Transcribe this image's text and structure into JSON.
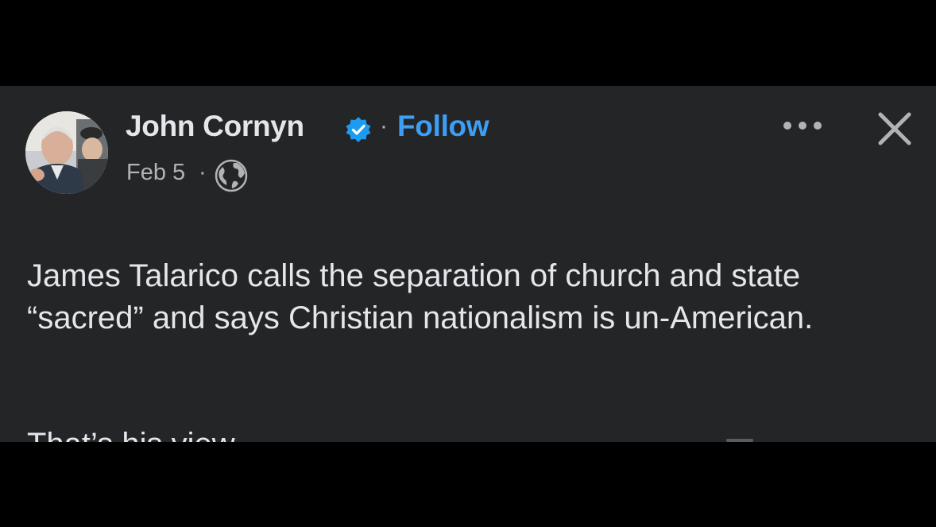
{
  "post": {
    "author": "John Cornyn",
    "separator": "·",
    "follow_label": "Follow",
    "date": "Feb 5",
    "date_separator": "·",
    "body_paragraph_1": "James Talarico calls the separation of church and state “sacred” and says Christian nationalism is un-American.",
    "body_paragraph_2": "That’s his view."
  },
  "icons": {
    "verified": "verified-badge-icon",
    "audience": "globe-icon",
    "more": "more-horizontal-icon",
    "close": "close-icon"
  },
  "colors": {
    "card_background": "#242526",
    "primary_text": "#e4e6eb",
    "secondary_text": "#b0b3b8",
    "accent_blue": "#3d9ef5",
    "page_background": "#000000"
  }
}
